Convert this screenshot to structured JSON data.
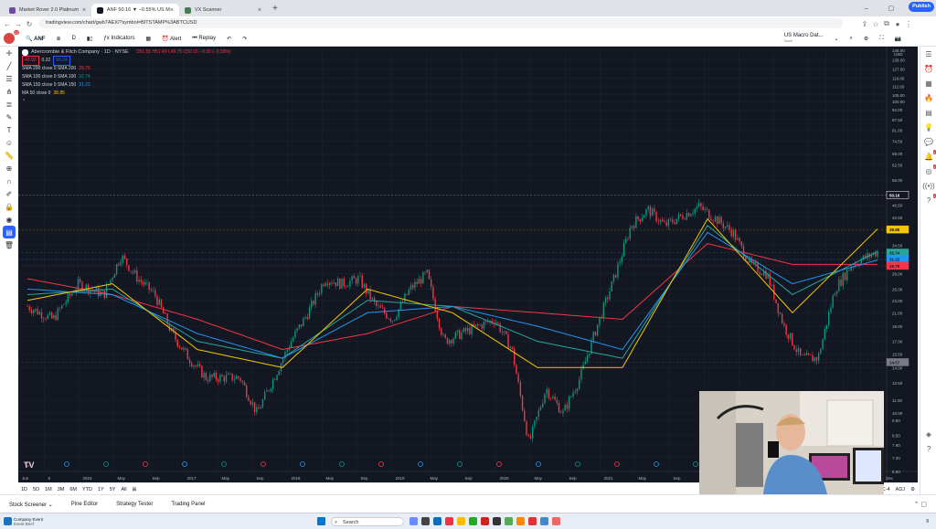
{
  "browser": {
    "tabs": [
      {
        "title": "Market Rover 2.0 Platinum",
        "color": "#6d4c9e"
      },
      {
        "title": "ANF 50.16 ▼ −0.55% US Macro...",
        "color": "#131722"
      },
      {
        "title": "VX Scanner",
        "color": "#4a7c59"
      }
    ],
    "url": "tradingview.com/chart/gwb7AEX/?symbol=BITSTAMP%3ABTCUSD"
  },
  "toolbar": {
    "symbol": "ANF",
    "timeframe": "D",
    "indicators": "Indicators",
    "alert": "Alert",
    "replay": "Replay",
    "layout_name": "US Macro Dat...",
    "layout_sub": "Save",
    "publish": "Publish",
    "avatar_badge": "12"
  },
  "legend": {
    "title": "Abercrombie & Fitch Company · 1D · NYSE",
    "ohlc": "O51.55 H51.49 L49.75 C50.16 −0.30 (−0.59%)",
    "bid": "49.92",
    "spread": "0.32",
    "ask": "50.24",
    "lines": [
      {
        "label": "SMA 200 close 0 SMA 200",
        "value": "29.70"
      },
      {
        "label": "SMA 100 close 0 SMA 100",
        "value": "32.74"
      },
      {
        "label": "SMA 150 close 0 SMA 150",
        "value": "31.22"
      },
      {
        "label": "MA 50 close 0",
        "value": "38.85"
      }
    ]
  },
  "chart_data": {
    "type": "line",
    "title": "Abercrombie & Fitch Company · 1D · NYSE",
    "currency": "USD",
    "yscale": "log",
    "ylim": [
      6.5,
      146
    ],
    "y_ticks": [
      "146.00",
      "136.00",
      "127.00",
      "119.00",
      "112.00",
      "105.00",
      "100.00",
      "94.00",
      "87.50",
      "81.00",
      "74.50",
      "68.00",
      "62.50",
      "56.00",
      "50.00",
      "46.50",
      "42.50",
      "38.50",
      "34.50",
      "31.00",
      "28.00",
      "25.00",
      "23.00",
      "21.00",
      "19.00",
      "17.00",
      "15.50",
      "14.00",
      "12.50",
      "11.00",
      "10.00",
      "9.50",
      "8.50",
      "7.90",
      "7.20",
      "6.50"
    ],
    "x_ticks": [
      "Jun",
      "8",
      "2016",
      "May",
      "Sep",
      "2017",
      "May",
      "Sep",
      "2018",
      "May",
      "Sep",
      "2019",
      "May",
      "Sep",
      "2020",
      "May",
      "Sep",
      "2021",
      "May",
      "Sep",
      "2022",
      "May",
      "Sep",
      "2023",
      "May",
      "Sep",
      "2024",
      "Jun",
      "Dec"
    ],
    "x_tick_positions": [
      0,
      0.03,
      0.07,
      0.11,
      0.15,
      0.19,
      0.23,
      0.27,
      0.31,
      0.35,
      0.39,
      0.43,
      0.47,
      0.51,
      0.55,
      0.59,
      0.63,
      0.67,
      0.71,
      0.75,
      0.79,
      0.83,
      0.87,
      0.91,
      0.93,
      0.95,
      0.97,
      0.985,
      0.995
    ],
    "price_labels": [
      {
        "value": "50.16",
        "color": "#ffffff"
      },
      {
        "value": "38.85",
        "color": "#f7c600"
      },
      {
        "value": "32.74",
        "color": "#26a69a"
      },
      {
        "value": "31.22",
        "color": "#2196f3"
      },
      {
        "value": "29.70",
        "color": "#f23645"
      },
      {
        "value": "14.57",
        "color": "#787b86"
      }
    ],
    "series": [
      {
        "name": "ANF",
        "style": "candles",
        "t": [
          0,
          0.03,
          0.06,
          0.09,
          0.11,
          0.13,
          0.15,
          0.17,
          0.19,
          0.21,
          0.23,
          0.25,
          0.27,
          0.29,
          0.31,
          0.33,
          0.35,
          0.37,
          0.39,
          0.41,
          0.43,
          0.45,
          0.47,
          0.49,
          0.51,
          0.53,
          0.55,
          0.57,
          0.59,
          0.61,
          0.63,
          0.65,
          0.67,
          0.69,
          0.71,
          0.73,
          0.75,
          0.77,
          0.79,
          0.81,
          0.83,
          0.85,
          0.87,
          0.89,
          0.91,
          0.93,
          0.95,
          0.97,
          1.0
        ],
        "values": [
          22,
          20,
          26,
          24,
          32,
          27,
          24,
          18,
          15,
          13,
          13,
          13,
          10,
          13,
          17,
          21,
          27,
          26,
          27,
          22,
          20,
          25,
          28,
          17,
          18,
          19,
          20,
          16,
          8,
          12,
          10,
          13,
          19,
          27,
          40,
          45,
          40,
          43,
          46,
          42,
          38,
          30,
          28,
          19,
          15,
          15,
          25,
          30,
          33,
          27,
          22,
          42,
          51,
          50
        ]
      },
      {
        "name": "SMA 200",
        "color": "#f23645",
        "t": [
          0,
          0.1,
          0.2,
          0.3,
          0.4,
          0.5,
          0.6,
          0.7,
          0.8,
          0.9,
          1.0
        ],
        "values": [
          27,
          24,
          20,
          16,
          18,
          22,
          21,
          20,
          35,
          30,
          30
        ]
      },
      {
        "name": "SMA 100",
        "color": "#26a69a",
        "t": [
          0,
          0.1,
          0.2,
          0.3,
          0.4,
          0.5,
          0.6,
          0.7,
          0.8,
          0.9,
          1.0
        ],
        "values": [
          24,
          25,
          17,
          15,
          23,
          22,
          17,
          15,
          40,
          24,
          33
        ]
      },
      {
        "name": "SMA 150",
        "color": "#2196f3",
        "t": [
          0,
          0.1,
          0.2,
          0.3,
          0.4,
          0.5,
          0.6,
          0.7,
          0.8,
          0.9,
          1.0
        ],
        "values": [
          25,
          24,
          18,
          15,
          21,
          22,
          19,
          16,
          38,
          26,
          31
        ]
      },
      {
        "name": "MA 50",
        "color": "#f7c600",
        "t": [
          0,
          0.1,
          0.2,
          0.3,
          0.4,
          0.5,
          0.6,
          0.7,
          0.8,
          0.9,
          1.0
        ],
        "values": [
          23,
          26,
          16,
          14,
          25,
          21,
          14,
          14,
          42,
          21,
          39
        ]
      }
    ],
    "grid": true,
    "legend": "top-left"
  },
  "timeframes": [
    "1D",
    "5D",
    "1M",
    "3M",
    "6M",
    "YTD",
    "1Y",
    "5Y",
    "All"
  ],
  "time_zone": "UTC-4",
  "adj": "ADJ",
  "panels": [
    "Stock Screener",
    "Pine Editor",
    "Strategy Tester",
    "Trading Panel"
  ],
  "taskbar": {
    "widget_title": "Company Event",
    "widget_sub": "Event Brief",
    "search": "Search",
    "time": "9"
  },
  "webcam": {
    "alt": "presenter webcam"
  }
}
